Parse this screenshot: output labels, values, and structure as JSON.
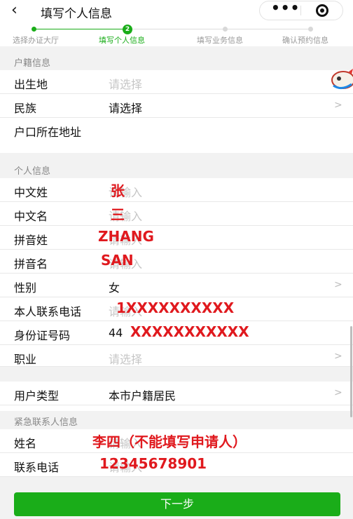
{
  "header": {
    "back_icon": "‹",
    "title": "填写个人信息",
    "more_icon": "•••",
    "close_icon": "close-circle-icon"
  },
  "steps": [
    {
      "label": "选择办证大厅",
      "state": "done"
    },
    {
      "label": "填写个人信息",
      "state": "active",
      "number": "2"
    },
    {
      "label": "填写业务信息",
      "state": "todo"
    },
    {
      "label": "确认预约信息",
      "state": "todo"
    }
  ],
  "sections": {
    "household": "户籍信息",
    "personal": "个人信息",
    "emergency": "紧急联系人信息"
  },
  "household": {
    "birthplace": {
      "label": "出生地",
      "value": "请选择"
    },
    "ethnicity": {
      "label": "民族",
      "value": "请选择"
    },
    "hukou_address": {
      "label": "户口所在地址"
    }
  },
  "personal": {
    "cn_surname": {
      "label": "中文姓",
      "placeholder": "请输入"
    },
    "cn_given": {
      "label": "中文名",
      "placeholder": "请输入"
    },
    "py_surname": {
      "label": "拼音姓",
      "placeholder": "请输入"
    },
    "py_given": {
      "label": "拼音名",
      "placeholder": "请输入"
    },
    "gender": {
      "label": "性别",
      "value": "女"
    },
    "phone": {
      "label": "本人联系电话",
      "placeholder": "请输入"
    },
    "id_number": {
      "label": "身份证号码",
      "value": "44"
    },
    "occupation": {
      "label": "职业",
      "value": "请选择"
    },
    "user_type": {
      "label": "用户类型",
      "value": "本市户籍居民"
    }
  },
  "emergency": {
    "name": {
      "label": "姓名",
      "placeholder": "请输入"
    },
    "phone": {
      "label": "联系电话",
      "placeholder": "请输入"
    }
  },
  "annotations": {
    "surname": "张",
    "given": "三",
    "py_surname": "ZHANG",
    "py_given": "SAN",
    "phone": "1XXXXXXXXXX",
    "id": "XXXXXXXXXXX",
    "emergency_name": "李四（不能填写申请人）",
    "emergency_phone": "12345678901"
  },
  "arrow": ">",
  "next_button": "下一步",
  "colors": {
    "accent": "#1aad19",
    "annotation": "#e0191e",
    "placeholder": "#c6c6c6"
  }
}
